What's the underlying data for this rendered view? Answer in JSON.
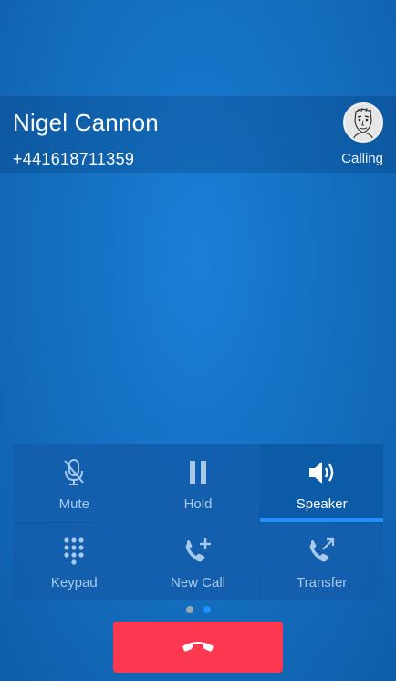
{
  "caller": {
    "name": "Nigel Cannon",
    "number": "+441618711359",
    "status": "Calling"
  },
  "controls": [
    {
      "label": "Mute",
      "icon": "mic-off-icon",
      "active": false
    },
    {
      "label": "Hold",
      "icon": "pause-icon",
      "active": false
    },
    {
      "label": "Speaker",
      "icon": "speaker-icon",
      "active": true
    },
    {
      "label": "Keypad",
      "icon": "keypad-icon",
      "active": false
    },
    {
      "label": "New Call",
      "icon": "phone-plus-icon",
      "active": false
    },
    {
      "label": "Transfer",
      "icon": "phone-transfer-icon",
      "active": false
    }
  ],
  "pager": {
    "pages": 2,
    "current": 2
  },
  "colors": {
    "accent": "#1e90ff",
    "hangup": "#fc3850",
    "inactive_label": "#a8c9ea"
  },
  "hangup": {
    "icon": "end-call-icon"
  }
}
